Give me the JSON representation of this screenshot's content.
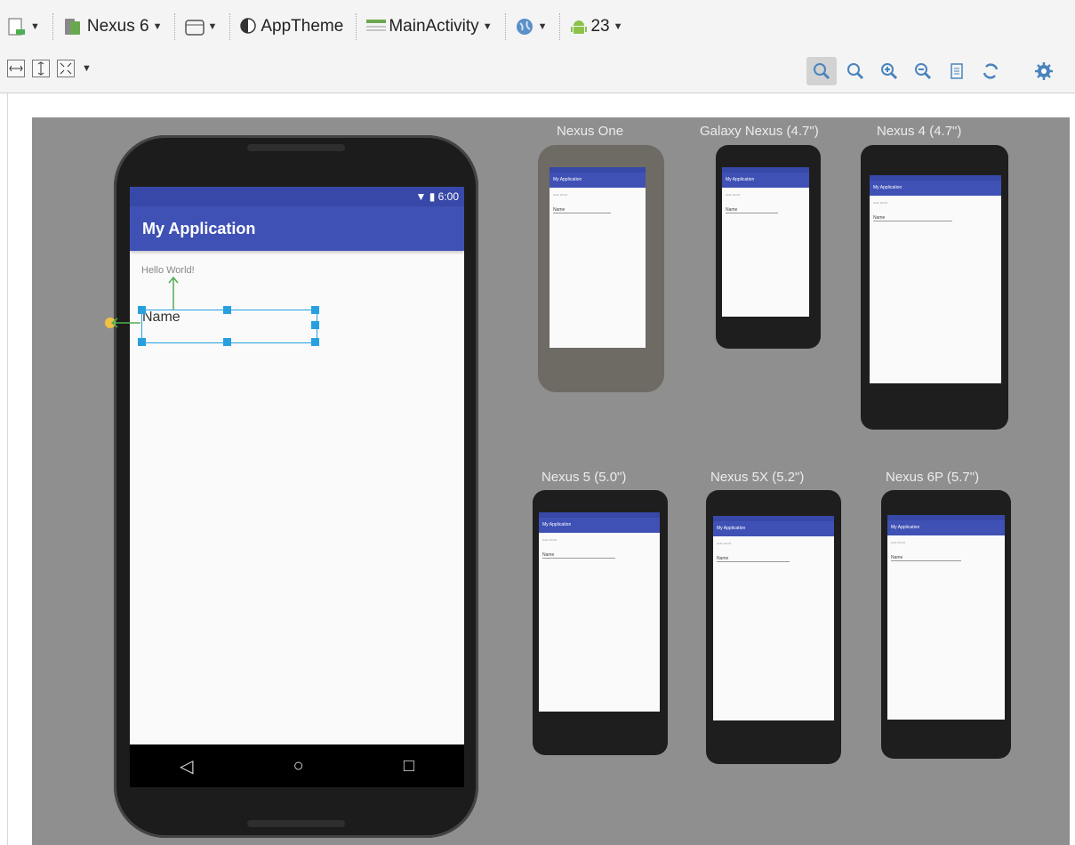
{
  "toolbar": {
    "device": "Nexus 6",
    "theme": "AppTheme",
    "activity": "MainActivity",
    "api_level": "23",
    "icons": [
      "design-surface-icon",
      "orientation-icon",
      "locale-icon",
      "android-icon",
      "fit-width-icon",
      "fit-height-icon",
      "expand-icon",
      "zoom-to-fit-icon",
      "actual-size-icon",
      "zoom-in-icon",
      "zoom-out-icon",
      "preview-icon",
      "refresh-icon",
      "settings-icon"
    ]
  },
  "main_device": {
    "status_time": "6:00",
    "app_title": "My Application",
    "hello_text": "Hello World!",
    "edit_text": "Name"
  },
  "previews": [
    {
      "label": "Nexus One"
    },
    {
      "label": "Galaxy Nexus (4.7\")"
    },
    {
      "label": "Nexus 4 (4.7\")"
    },
    {
      "label": "Nexus 5 (5.0\")"
    },
    {
      "label": "Nexus 5X (5.2\")"
    },
    {
      "label": "Nexus 6P (5.7\")"
    }
  ],
  "colors": {
    "primary": "#3f51b5",
    "primary_dark": "#3848a8",
    "canvas": "#8f8f8f",
    "selection": "#28a0e0"
  }
}
